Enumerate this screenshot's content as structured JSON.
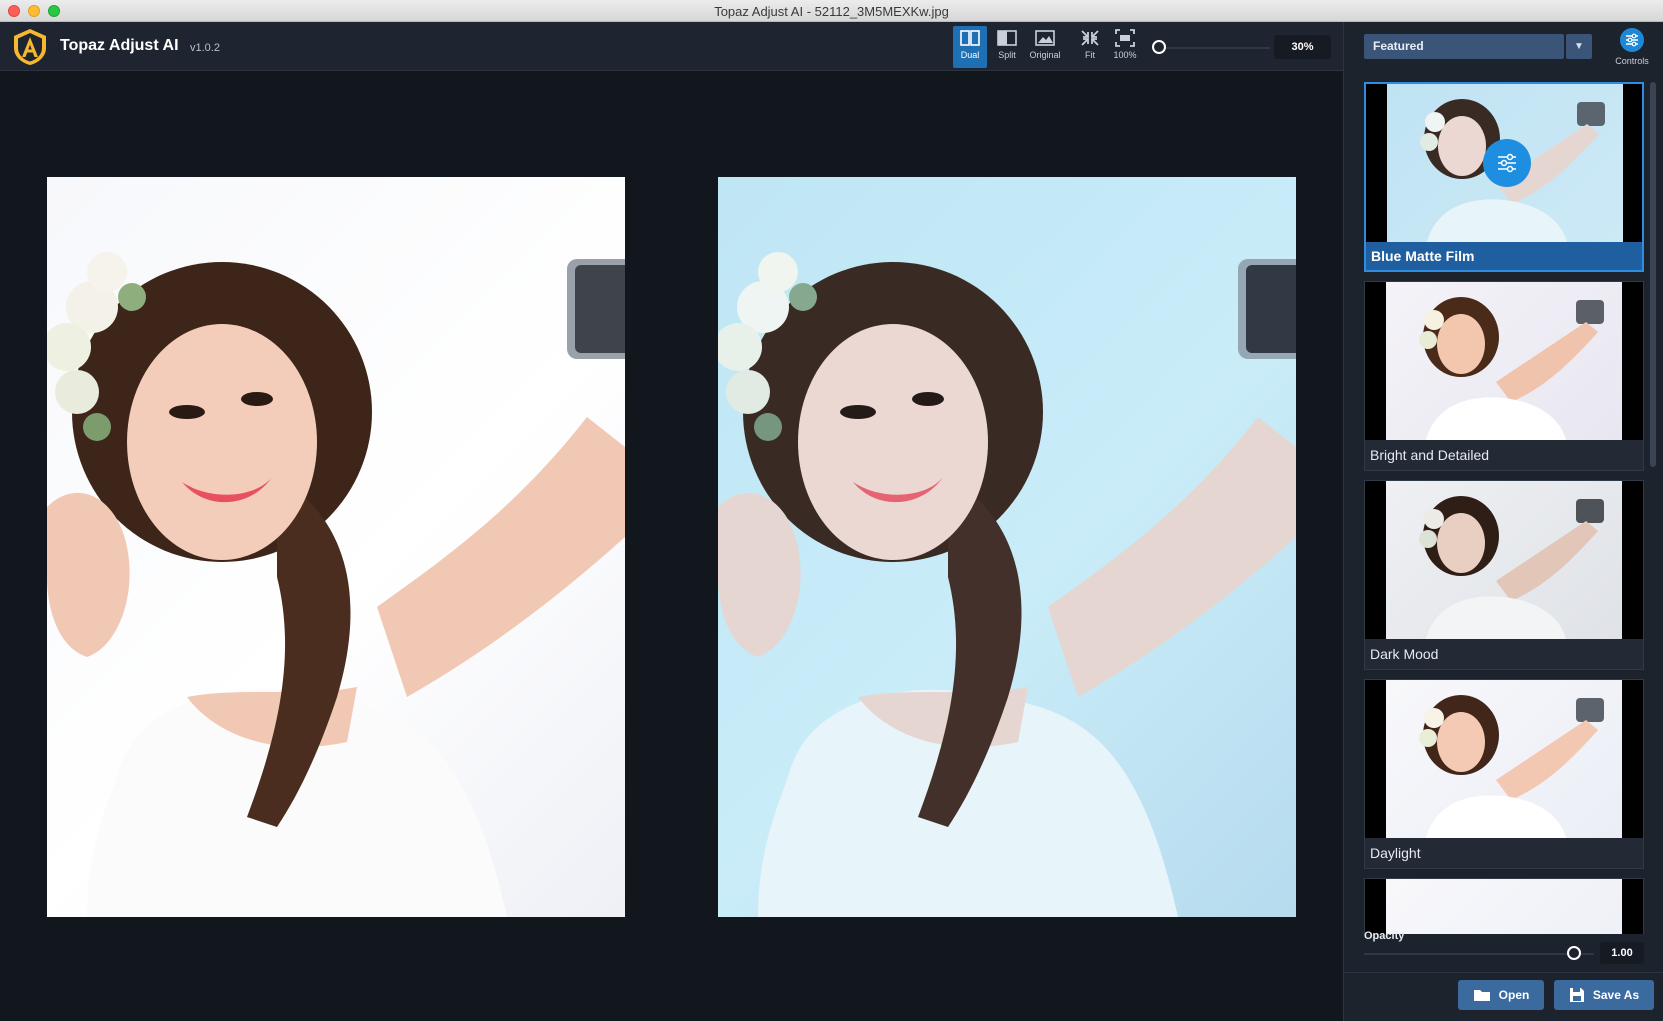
{
  "window": {
    "title": "Topaz Adjust AI - 52112_3M5MEXKw.jpg"
  },
  "app": {
    "name": "Topaz Adjust AI",
    "version": "v1.0.2"
  },
  "toolbar": {
    "dual_label": "Dual",
    "split_label": "Split",
    "original_label": "Original",
    "fit_label": "Fit",
    "actual_label": "100%",
    "zoom_value": "30%"
  },
  "panel": {
    "category": "Featured",
    "controls_label": "Controls",
    "presets": [
      {
        "label": "Blue Matte Film",
        "selected": true
      },
      {
        "label": "Bright and Detailed",
        "selected": false
      },
      {
        "label": "Dark Mood",
        "selected": false
      },
      {
        "label": "Daylight",
        "selected": false
      }
    ],
    "opacity_label": "Opacity",
    "opacity_value": "1.00",
    "open_label": "Open",
    "save_label": "Save As"
  },
  "colors": {
    "accent": "#1f6fb5",
    "selected_border": "#2e8de0",
    "button": "#3a6a9e",
    "processed_tint": "#c9ecf8"
  }
}
